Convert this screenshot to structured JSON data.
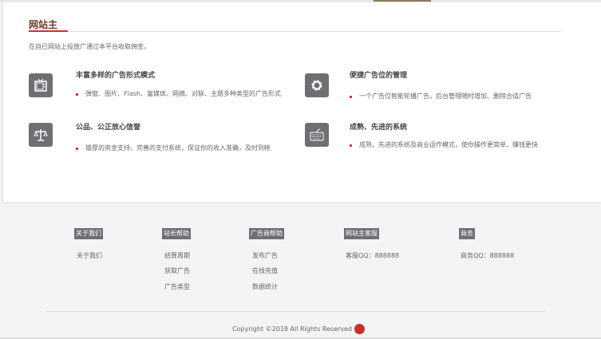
{
  "section": {
    "title": "网站主",
    "description": "在自已网站上投放广通过本平台收取佣金。"
  },
  "features": [
    {
      "icon": "tv-icon",
      "title": "丰富多样的广告形式模式",
      "text": "弹窗、图片、Flash、富媒体、网摘、对联、主题多种类型的广告形式"
    },
    {
      "icon": "gear-icon",
      "title": "便捷广告位的管理",
      "text": "一个广告位智能轮播广告，后台管理随时增加、删除合适广告"
    },
    {
      "icon": "scale-icon",
      "title": "公品、公正放心信誉",
      "text": "雄厚的资金支持，完善的支付系统，保证你的收入准确，及时到帐"
    },
    {
      "icon": "keyboard-icon",
      "title": "成熟、先进的系统",
      "text": "成熟、先进的系统及商业运作模式，使你操作更简单，赚钱更快"
    }
  ],
  "footer": {
    "columns": [
      {
        "title": "关于我们",
        "items": [
          "关于我们"
        ]
      },
      {
        "title": "站长帮助",
        "items": [
          "结算周期",
          "获取广告",
          "广告类型"
        ]
      },
      {
        "title": "广告商帮助",
        "items": [
          "发布广告",
          "在线充值",
          "数据统计"
        ]
      },
      {
        "title": "网站主客服",
        "items": [
          "客服QQ：888888"
        ]
      },
      {
        "title": "商务",
        "items": [
          "商务QQ：888888"
        ]
      }
    ],
    "copyright": "Copyright ©2018 All Rights Reserved",
    "logo_letter": "Z"
  },
  "colors": {
    "accent": "#c9302c",
    "icon_bg": "#6f6f73",
    "bullet": "#d0021b"
  }
}
